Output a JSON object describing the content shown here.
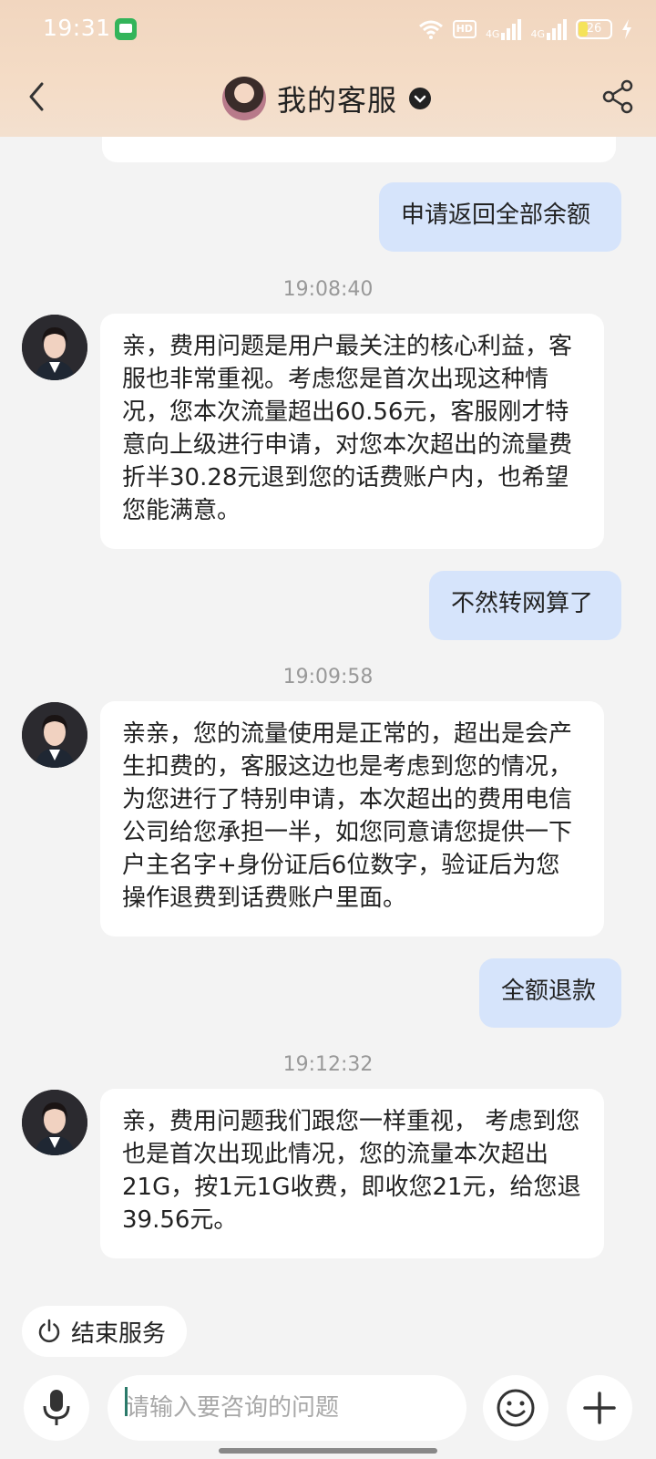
{
  "status": {
    "time": "19:31",
    "network1": "4G",
    "network2": "4G",
    "hd": "HD",
    "battery": "26"
  },
  "header": {
    "title": "我的客服"
  },
  "messages": [
    {
      "role": "user",
      "text": "申请返回全部余额"
    },
    {
      "role": "time",
      "text": "19:08:40"
    },
    {
      "role": "agent",
      "text": "亲，费用问题是用户最关注的核心利益，客服也非常重视。考虑您是首次出现这种情况，您本次流量超出60.56元，客服刚才特意向上级进行申请，对您本次超出的流量费折半30.28元退到您的话费账户内，也希望您能满意。"
    },
    {
      "role": "user",
      "text": "不然转网算了"
    },
    {
      "role": "time",
      "text": "19:09:58"
    },
    {
      "role": "agent",
      "text": "亲亲，您的流量使用是正常的，超出是会产生扣费的，客服这边也是考虑到您的情况，为您进行了特别申请，本次超出的费用电信公司给您承担一半，如您同意请您提供一下户主名字+身份证后6位数字，验证后为您操作退费到话费账户里面。"
    },
    {
      "role": "user",
      "text": "全额退款"
    },
    {
      "role": "time",
      "text": "19:12:32"
    },
    {
      "role": "agent",
      "text": "亲，费用问题我们跟您一样重视， 考虑到您也是首次出现此情况，您的流量本次超出21G，按1元1G收费，即收您21元，给您退39.56元。"
    }
  ],
  "end_service": {
    "label": "结束服务"
  },
  "input": {
    "placeholder": "请输入要咨询的问题"
  }
}
